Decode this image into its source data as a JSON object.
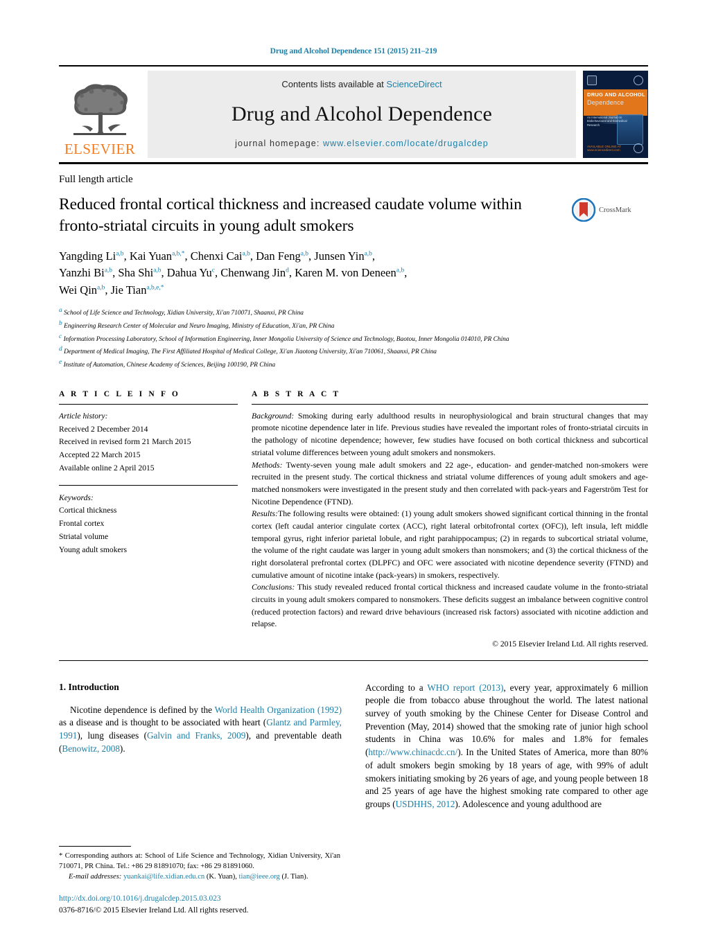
{
  "running_head": "Drug and Alcohol Dependence 151 (2015) 211–219",
  "masthead": {
    "contents_prefix": "Contents lists available at ",
    "sciencedirect": "ScienceDirect",
    "journal_title": "Drug and Alcohol Dependence",
    "homepage_label": "journal homepage:",
    "homepage_url": "www.elsevier.com/locate/drugalcdep",
    "publisher_logo_word": "ELSEVIER",
    "cover": {
      "title_line1": "DRUG AND ALCOHOL",
      "title_line2": "Dependence",
      "caption": "An International Journal on Biobehavioural and Biomedical Research",
      "foot": "AVAILABLE ONLINE AT\nwww.sciencedirect.com"
    }
  },
  "article_type": "Full length article",
  "title": "Reduced frontal cortical thickness and increased caudate volume within fronto-striatal circuits in young adult smokers",
  "crossmark_label": "CrossMark",
  "authors_lines": [
    "Yangding Li a,b, Kai Yuan a,b,*, Chenxi Cai a,b, Dan Feng a,b, Junsen Yin a,b,",
    "Yanzhi Bi a,b, Sha Shi a,b, Dahua Yu c, Chenwang Jin d, Karen M. von Deneen a,b,",
    "Wei Qin a,b, Jie Tian a,b,e,*"
  ],
  "affiliations": [
    {
      "marker": "a",
      "text": "School of Life Science and Technology, Xidian University, Xi'an 710071, Shaanxi, PR China"
    },
    {
      "marker": "b",
      "text": "Engineering Research Center of Molecular and Neuro Imaging, Ministry of Education, Xi'an, PR China"
    },
    {
      "marker": "c",
      "text": "Information Processing Laboratory, School of Information Engineering, Inner Mongolia University of Science and Technology, Baotou, Inner Mongolia 014010, PR China"
    },
    {
      "marker": "d",
      "text": "Department of Medical Imaging, The First Affiliated Hospital of Medical College, Xi'an Jiaotong University, Xi'an 710061, Shaanxi, PR China"
    },
    {
      "marker": "e",
      "text": "Institute of Automation, Chinese Academy of Sciences, Beijing 100190, PR China"
    }
  ],
  "article_info": {
    "heading": "A R T I C L E  I N F O",
    "history_label": "Article history:",
    "history": [
      "Received 2 December 2014",
      "Received in revised form 21 March 2015",
      "Accepted 22 March 2015",
      "Available online 2 April 2015"
    ],
    "keywords_label": "Keywords:",
    "keywords": [
      "Cortical thickness",
      "Frontal cortex",
      "Striatal volume",
      "Young adult smokers"
    ]
  },
  "abstract": {
    "heading": "A B S T R A C T",
    "background_label": "Background:",
    "background": " Smoking during early adulthood results in neurophysiological and brain structural changes that may promote nicotine dependence later in life. Previous studies have revealed the important roles of fronto-striatal circuits in the pathology of nicotine dependence; however, few studies have focused on both cortical thickness and subcortical striatal volume differences between young adult smokers and nonsmokers.",
    "methods_label": "Methods:",
    "methods": " Twenty-seven young male adult smokers and 22 age-, education- and gender-matched non-smokers were recruited in the present study. The cortical thickness and striatal volume differences of young adult smokers and age-matched nonsmokers were investigated in the present study and then correlated with pack-years and Fagerström Test for Nicotine Dependence (FTND).",
    "results_label": "Results:",
    "results": "The following results were obtained: (1) young adult smokers showed significant cortical thinning in the frontal cortex (left caudal anterior cingulate cortex (ACC), right lateral orbitofrontal cortex (OFC)), left insula, left middle temporal gyrus, right inferior parietal lobule, and right parahippocampus; (2) in regards to subcortical striatal volume, the volume of the right caudate was larger in young adult smokers than nonsmokers; and (3) the cortical thickness of the right dorsolateral prefrontal cortex (DLPFC) and OFC were associated with nicotine dependence severity (FTND) and cumulative amount of nicotine intake (pack-years) in smokers, respectively.",
    "conclusions_label": "Conclusions:",
    "conclusions": " This study revealed reduced frontal cortical thickness and increased caudate volume in the fronto-striatal circuits in young adult smokers compared to nonsmokers. These deficits suggest an imbalance between cognitive control (reduced protection factors) and reward drive behaviours (increased risk factors) associated with nicotine addiction and relapse.",
    "copyright": "© 2015 Elsevier Ireland Ltd. All rights reserved."
  },
  "body": {
    "section_number_title": "1.  Introduction",
    "left_paragraph_parts": [
      {
        "t": "Nicotine dependence is defined by the ",
        "link": false
      },
      {
        "t": "World Health Organization (1992)",
        "link": true
      },
      {
        "t": " as a disease and is thought to be associated with heart (",
        "link": false
      },
      {
        "t": "Glantz and Parmley, 1991",
        "link": true
      },
      {
        "t": "), lung diseases (",
        "link": false
      },
      {
        "t": "Galvin and Franks, 2009",
        "link": true
      },
      {
        "t": "), and preventable death (",
        "link": false
      },
      {
        "t": "Benowitz, 2008",
        "link": true
      },
      {
        "t": ").",
        "link": false
      }
    ],
    "right_paragraph_parts": [
      {
        "t": "According to a ",
        "link": false
      },
      {
        "t": "WHO report (2013)",
        "link": true
      },
      {
        "t": ", every year, approximately 6 million people die from tobacco abuse throughout the world. The latest national survey of youth smoking by the Chinese Center for Disease Control and Prevention (May, 2014) showed that the smoking rate of junior high school students in China was 10.6% for males and 1.8% for females (",
        "link": false
      },
      {
        "t": "http://www.chinacdc.cn/",
        "link": true
      },
      {
        "t": "). In the United States of America, more than 80% of adult smokers begin smoking by 18 years of age, with 99% of adult smokers initiating smoking by 26 years of age, and young people between 18 and 25 years of age have the highest smoking rate compared to other age groups (",
        "link": false
      },
      {
        "t": "USDHHS, 2012",
        "link": true
      },
      {
        "t": "). Adolescence and young adulthood are",
        "link": false
      }
    ]
  },
  "footnotes": {
    "corresponding_parts": [
      {
        "t": "*  Corresponding authors at: School of Life Science and Technology, Xidian University, Xi'an 710071, PR China. Tel.: +86 29 81891070; fax: +86 29 81891060.",
        "link": false
      }
    ],
    "email_label": "E-mail addresses:",
    "emails": [
      {
        "address": "yuankai@life.xidian.edu.cn",
        "owner": "(K. Yuan)"
      },
      {
        "address": "tian@ieee.org",
        "owner": "(J. Tian)"
      }
    ]
  },
  "doi": "http://dx.doi.org/10.1016/j.drugalcdep.2015.03.023",
  "issn_line": "0376-8716/© 2015 Elsevier Ireland Ltd. All rights reserved.",
  "colors": {
    "link_blue": "#1b7fa8",
    "elsevier_orange": "#F47C20",
    "band_gray": "#ececec"
  }
}
